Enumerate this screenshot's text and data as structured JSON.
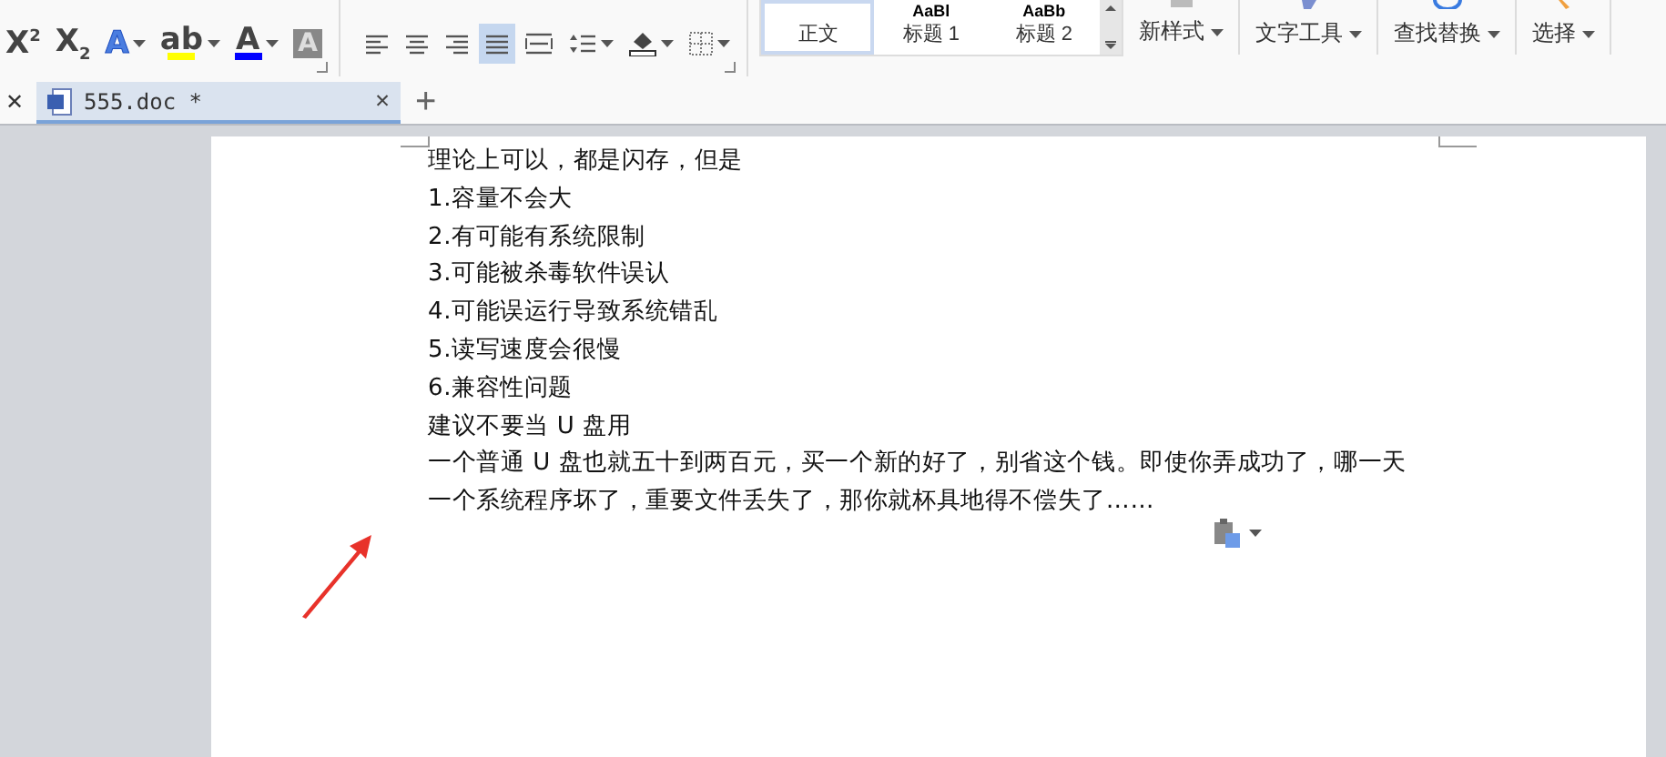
{
  "toolbar": {
    "font_buttons": [
      {
        "kind": "superscript",
        "label": "X$^{2}$",
        "dropdown": false
      },
      {
        "kind": "subscript",
        "label": "X$_{2}$",
        "dropdown": false
      },
      {
        "kind": "text-effect",
        "label": "A",
        "dropdown": true
      },
      {
        "kind": "highlight",
        "label": "ab",
        "color": "#ffff00",
        "dropdown": true
      },
      {
        "kind": "font-color",
        "label": "A",
        "color": "#0000ff",
        "dropdown": true
      },
      {
        "kind": "char-shading",
        "label": "A",
        "dropdown": false
      }
    ],
    "paragraph_buttons": [
      {
        "kind": "align-left",
        "selected": false,
        "dropdown": false
      },
      {
        "kind": "align-center",
        "selected": false,
        "dropdown": false
      },
      {
        "kind": "align-right",
        "selected": false,
        "dropdown": false
      },
      {
        "kind": "justify",
        "selected": true,
        "dropdown": false
      },
      {
        "kind": "distributed",
        "selected": false,
        "dropdown": false
      },
      {
        "kind": "line-spacing",
        "selected": false,
        "dropdown": true
      },
      {
        "kind": "shading",
        "selected": false,
        "dropdown": true
      },
      {
        "kind": "borders",
        "selected": false,
        "dropdown": true
      }
    ],
    "styles": [
      {
        "label": "正文",
        "selected": true
      },
      {
        "label": "标题 1",
        "preview": "AaBl",
        "selected": false
      },
      {
        "label": "标题 2",
        "preview": "AaBb",
        "selected": false
      }
    ],
    "tools": [
      {
        "kind": "new-style",
        "label": "新样式"
      },
      {
        "kind": "text-tools",
        "label": "文字工具"
      },
      {
        "kind": "find-replace",
        "label": "查找替换"
      },
      {
        "kind": "select",
        "label": "选择"
      }
    ]
  },
  "tab_bar": {
    "previous_tab_close": "✕",
    "close": "✕",
    "new_tab": "+"
  },
  "tabs": [
    {
      "label": "555.doc *",
      "selected": true
    }
  ],
  "document": {
    "paragraphs": [
      "理论上可以，都是闪存，但是",
      "1.容量不会大",
      "2.有可能有系统限制",
      "3.可能被杀毒软件误认",
      "4.可能误运行导致系统错乱",
      "5.读写速度会很慢",
      "6.兼容性问题",
      "建议不要当 U 盘用",
      "一个普通 U 盘也就五十到两百元，买一个新的好了，别省这个钱。即使你弄成功了，哪一天一个系统程序坏了，重要文件丢失了，那你就杯具地得不偿失了……"
    ]
  }
}
